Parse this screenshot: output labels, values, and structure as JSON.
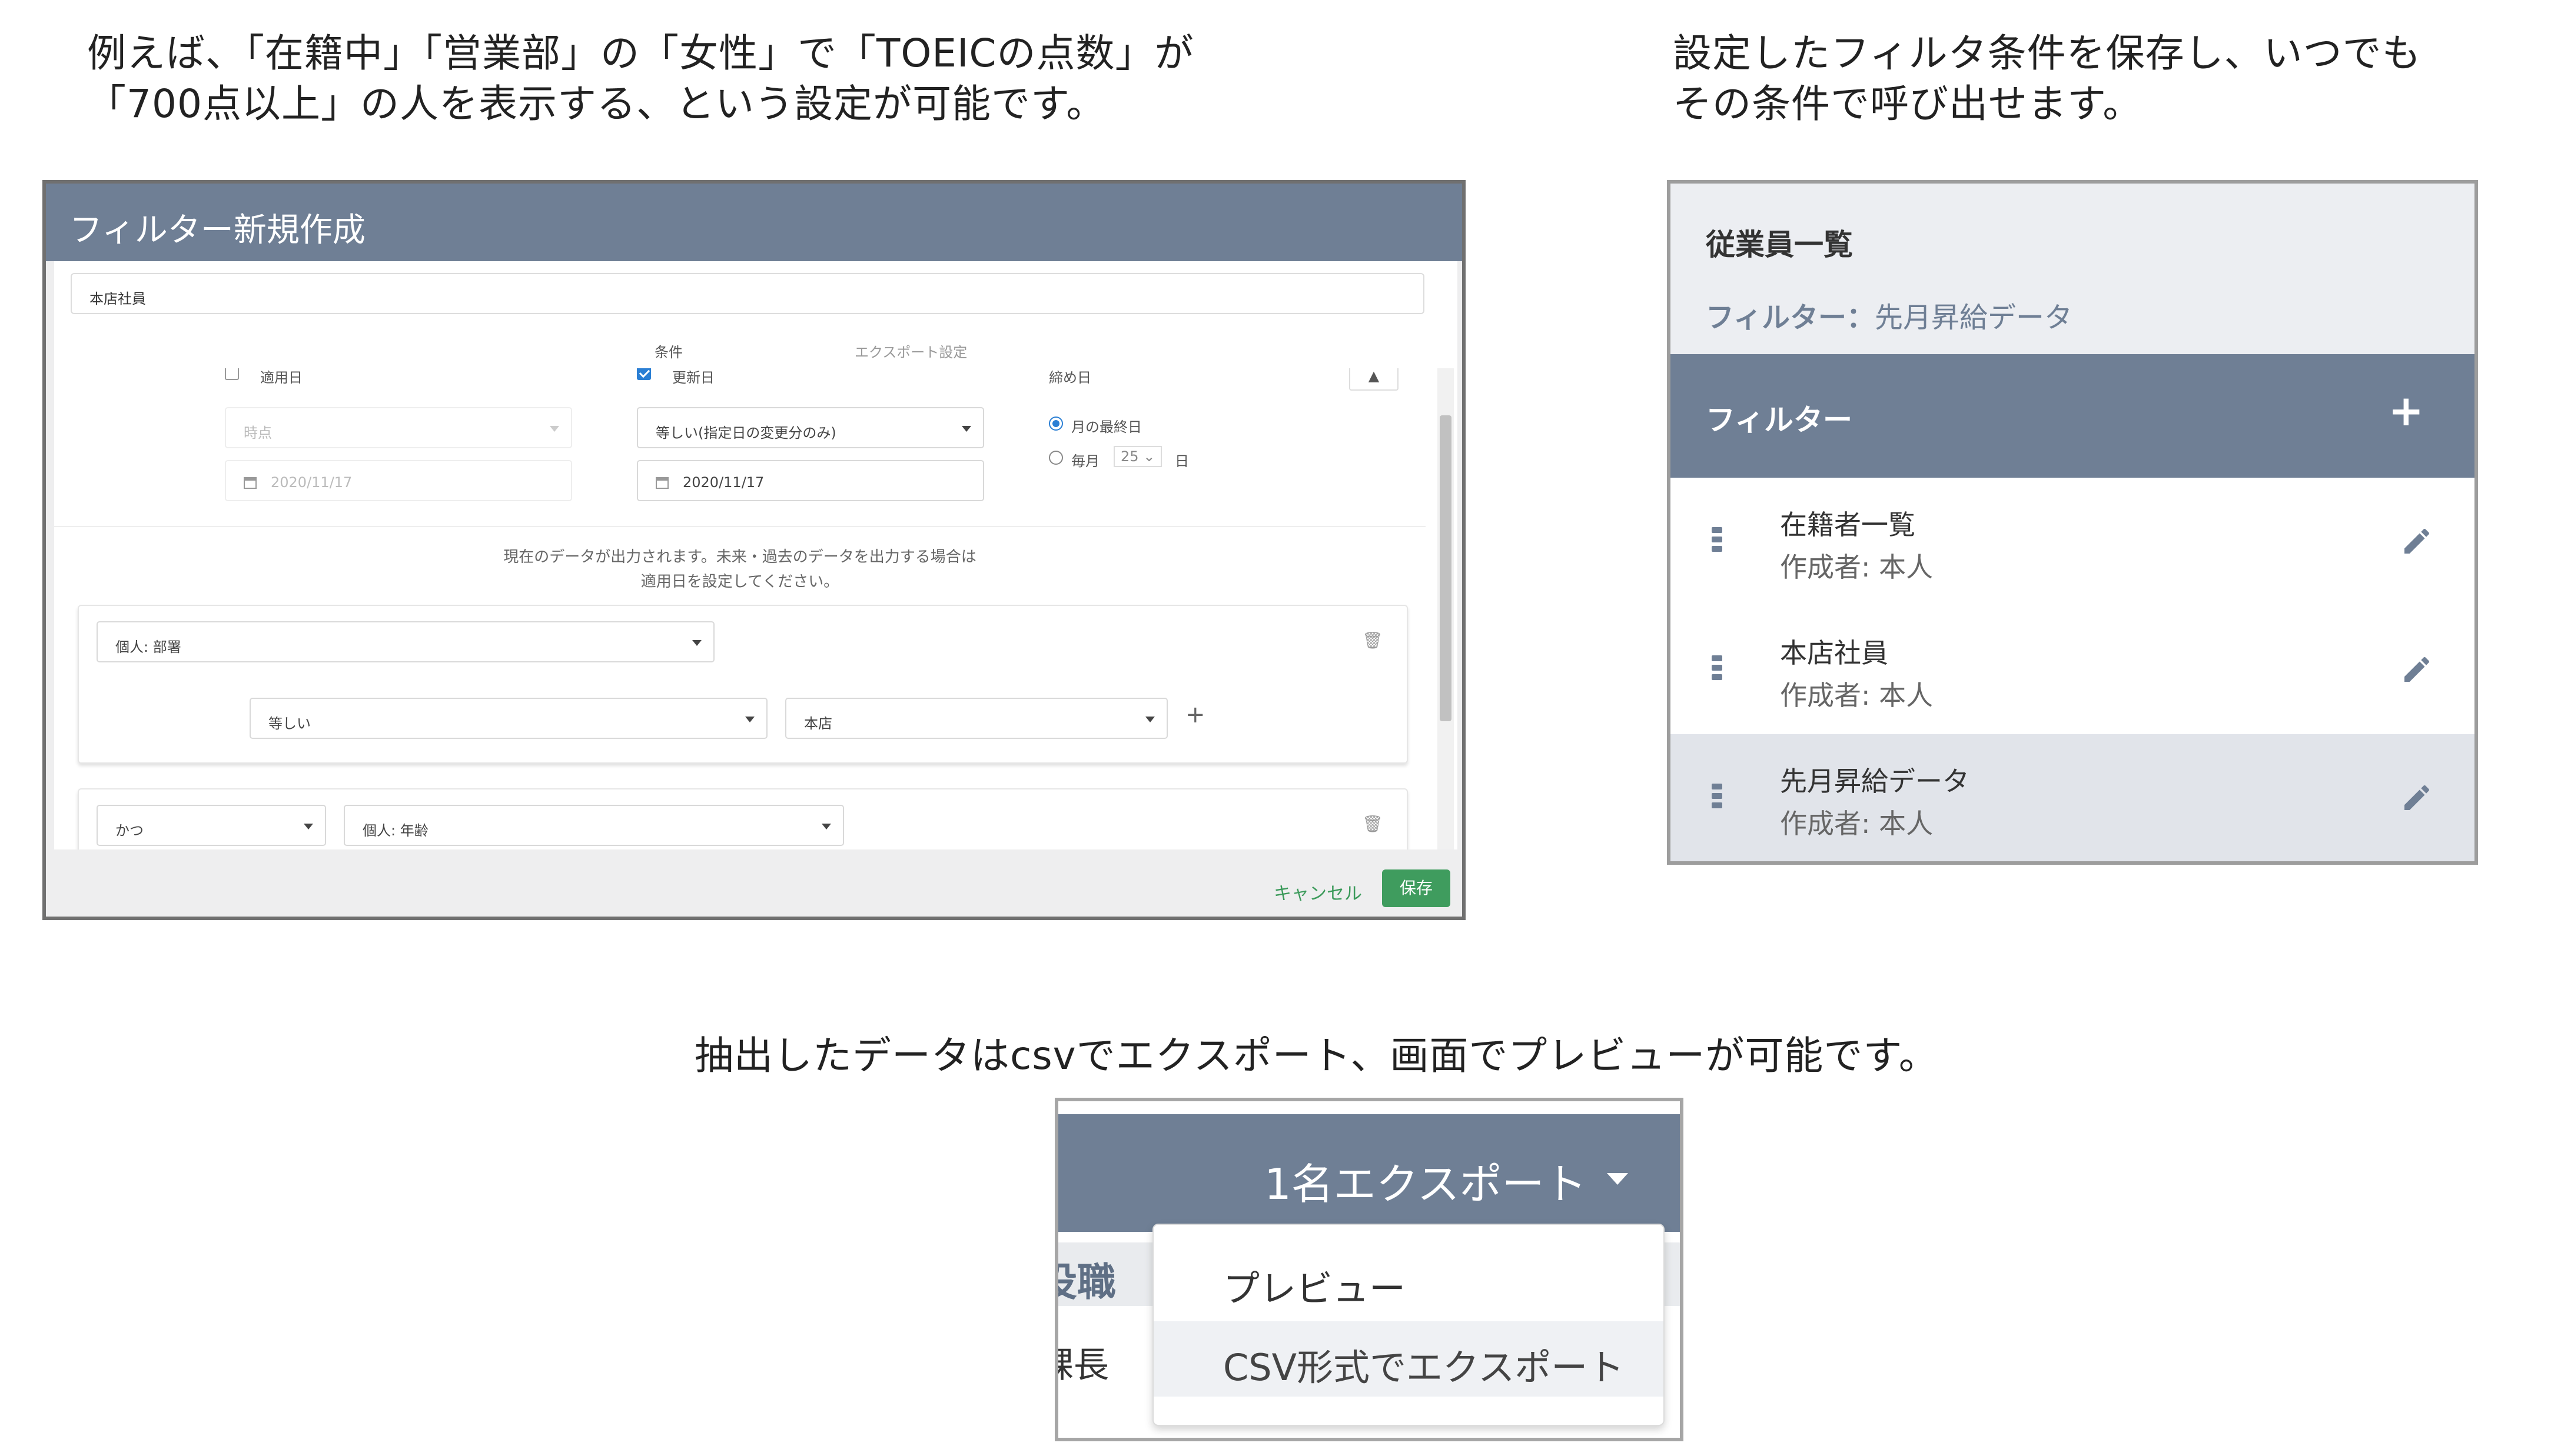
{
  "captions": {
    "filter_line1": "例えば、「在籍中」「営業部」の「女性」で「TOEICの点数」が",
    "filter_line2": "「700点以上」の人を表示する、という設定が可能です。",
    "save_line1": "設定したフィルタ条件を保存し、いつでも",
    "save_line2": "その条件で呼び出せます。",
    "export_line": "抽出したデータはcsvでエクスポート、画面でプレビューが可能です。"
  },
  "filter_modal": {
    "title": "フィルター新規作成",
    "name_value": "本店社員",
    "tabs": [
      "条件",
      "エクスポート設定"
    ],
    "date_options": {
      "apply_date_label": "適用日",
      "apply_date_checked": false,
      "update_date_label": "更新日",
      "update_date_checked": true,
      "closing_date_label": "締め日",
      "time_select": "時点",
      "time_date": "2020/11/17",
      "update_select": "等しい(指定日の変更分のみ)",
      "update_date": "2020/11/17",
      "radio_end_of_month": "月の最終日",
      "radio_monthly": "毎月",
      "monthly_day": "25",
      "day_suffix": "日"
    },
    "note_line1": "現在のデータが出力されます。未来・過去のデータを出力する場合は",
    "note_line2": "適用日を設定してください。",
    "condition1": {
      "field": "個人: 部署",
      "operator": "等しい",
      "value": "本店"
    },
    "condition2": {
      "logic": "かつ",
      "field": "個人: 年齢"
    },
    "cancel_label": "キャンセル",
    "save_label": "保存"
  },
  "employee_panel": {
    "title": "従業員一覧",
    "filter_label": "フィルター：",
    "filter_value": "先月昇給データ",
    "section_title": "フィルター",
    "add_icon": "+",
    "items": [
      {
        "name": "在籍者一覧",
        "owner": "作成者: 本人",
        "selected": false
      },
      {
        "name": "本店社員",
        "owner": "作成者: 本人",
        "selected": false
      },
      {
        "name": "先月昇給データ",
        "owner": "作成者: 本人",
        "selected": true
      }
    ]
  },
  "export": {
    "button_label": "1名エクスポート",
    "column_header_fragment": "役職",
    "cell_fragment": "課長",
    "menu": [
      "プレビュー",
      "CSV形式でエクスポート"
    ]
  },
  "colors": {
    "header_slate": "#6f7f95",
    "save_green": "#3f9c5e",
    "checkbox_blue": "#2b7fd4"
  }
}
